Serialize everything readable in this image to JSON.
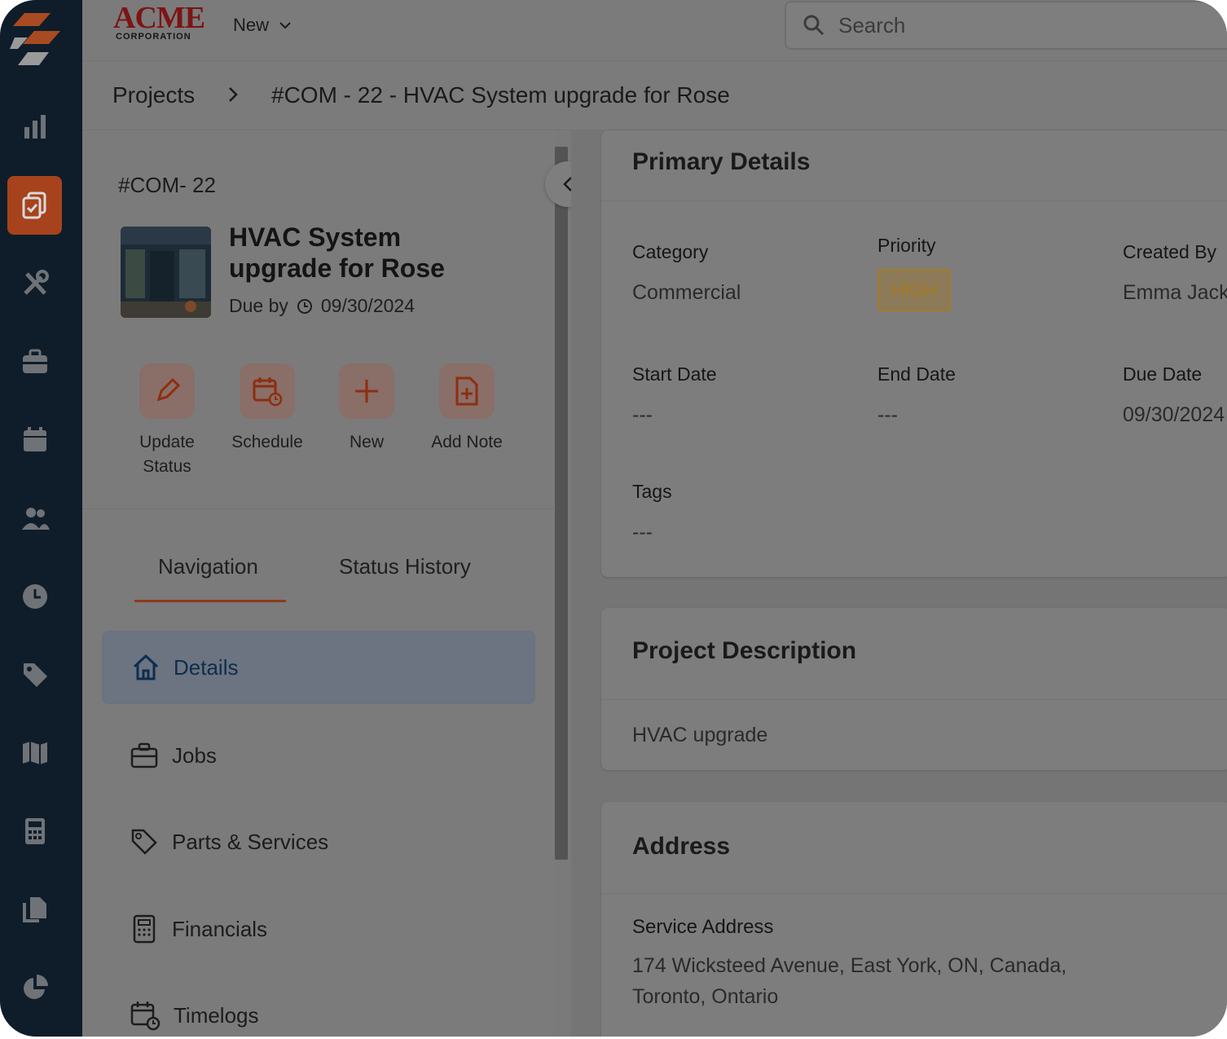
{
  "brand": {
    "name": "ACME",
    "sub": "CORPORATION"
  },
  "topbar": {
    "new_label": "New",
    "search_placeholder": "Search"
  },
  "breadcrumb": {
    "root": "Projects",
    "current": "#COM - 22 - HVAC System upgrade for Rose"
  },
  "project": {
    "id": "#COM- 22",
    "title": "HVAC System upgrade for Rose",
    "due_prefix": "Due by",
    "due_date": "09/30/2024"
  },
  "actions": [
    {
      "label": "Update\nStatus",
      "icon": "pencil-icon"
    },
    {
      "label": "Schedule",
      "icon": "calendar-clock-icon"
    },
    {
      "label": "New",
      "icon": "plus-icon"
    },
    {
      "label": "Add Note",
      "icon": "note-add-icon"
    }
  ],
  "tabs": {
    "navigation": "Navigation",
    "status_history": "Status History"
  },
  "nav": [
    {
      "label": "Details",
      "icon": "home-icon",
      "active": true
    },
    {
      "label": "Jobs",
      "icon": "briefcase-icon"
    },
    {
      "label": "Parts & Services",
      "icon": "tag-icon"
    },
    {
      "label": "Financials",
      "icon": "calculator-icon"
    },
    {
      "label": "Timelogs",
      "icon": "calendar-clock-icon"
    }
  ],
  "primary": {
    "title": "Primary Details",
    "category_label": "Category",
    "category": "Commercial",
    "priority_label": "Priority",
    "priority": "HIGH",
    "created_by_label": "Created By",
    "created_by": "Emma Jack",
    "start_label": "Start Date",
    "start": "---",
    "end_label": "End Date",
    "end": "---",
    "due_label": "Due Date",
    "due": "09/30/2024",
    "tags_label": "Tags",
    "tags": "---"
  },
  "description": {
    "title": "Project Description",
    "text": "HVAC upgrade"
  },
  "address": {
    "title": "Address",
    "service_label": "Service Address",
    "line1": "174 Wicksteed Avenue, East York, ON, Canada,",
    "line2": "Toronto, Ontario"
  },
  "colors": {
    "accent": "#e0592a",
    "sidebar": "#0f1d2b",
    "priority": "#f2a51f"
  }
}
